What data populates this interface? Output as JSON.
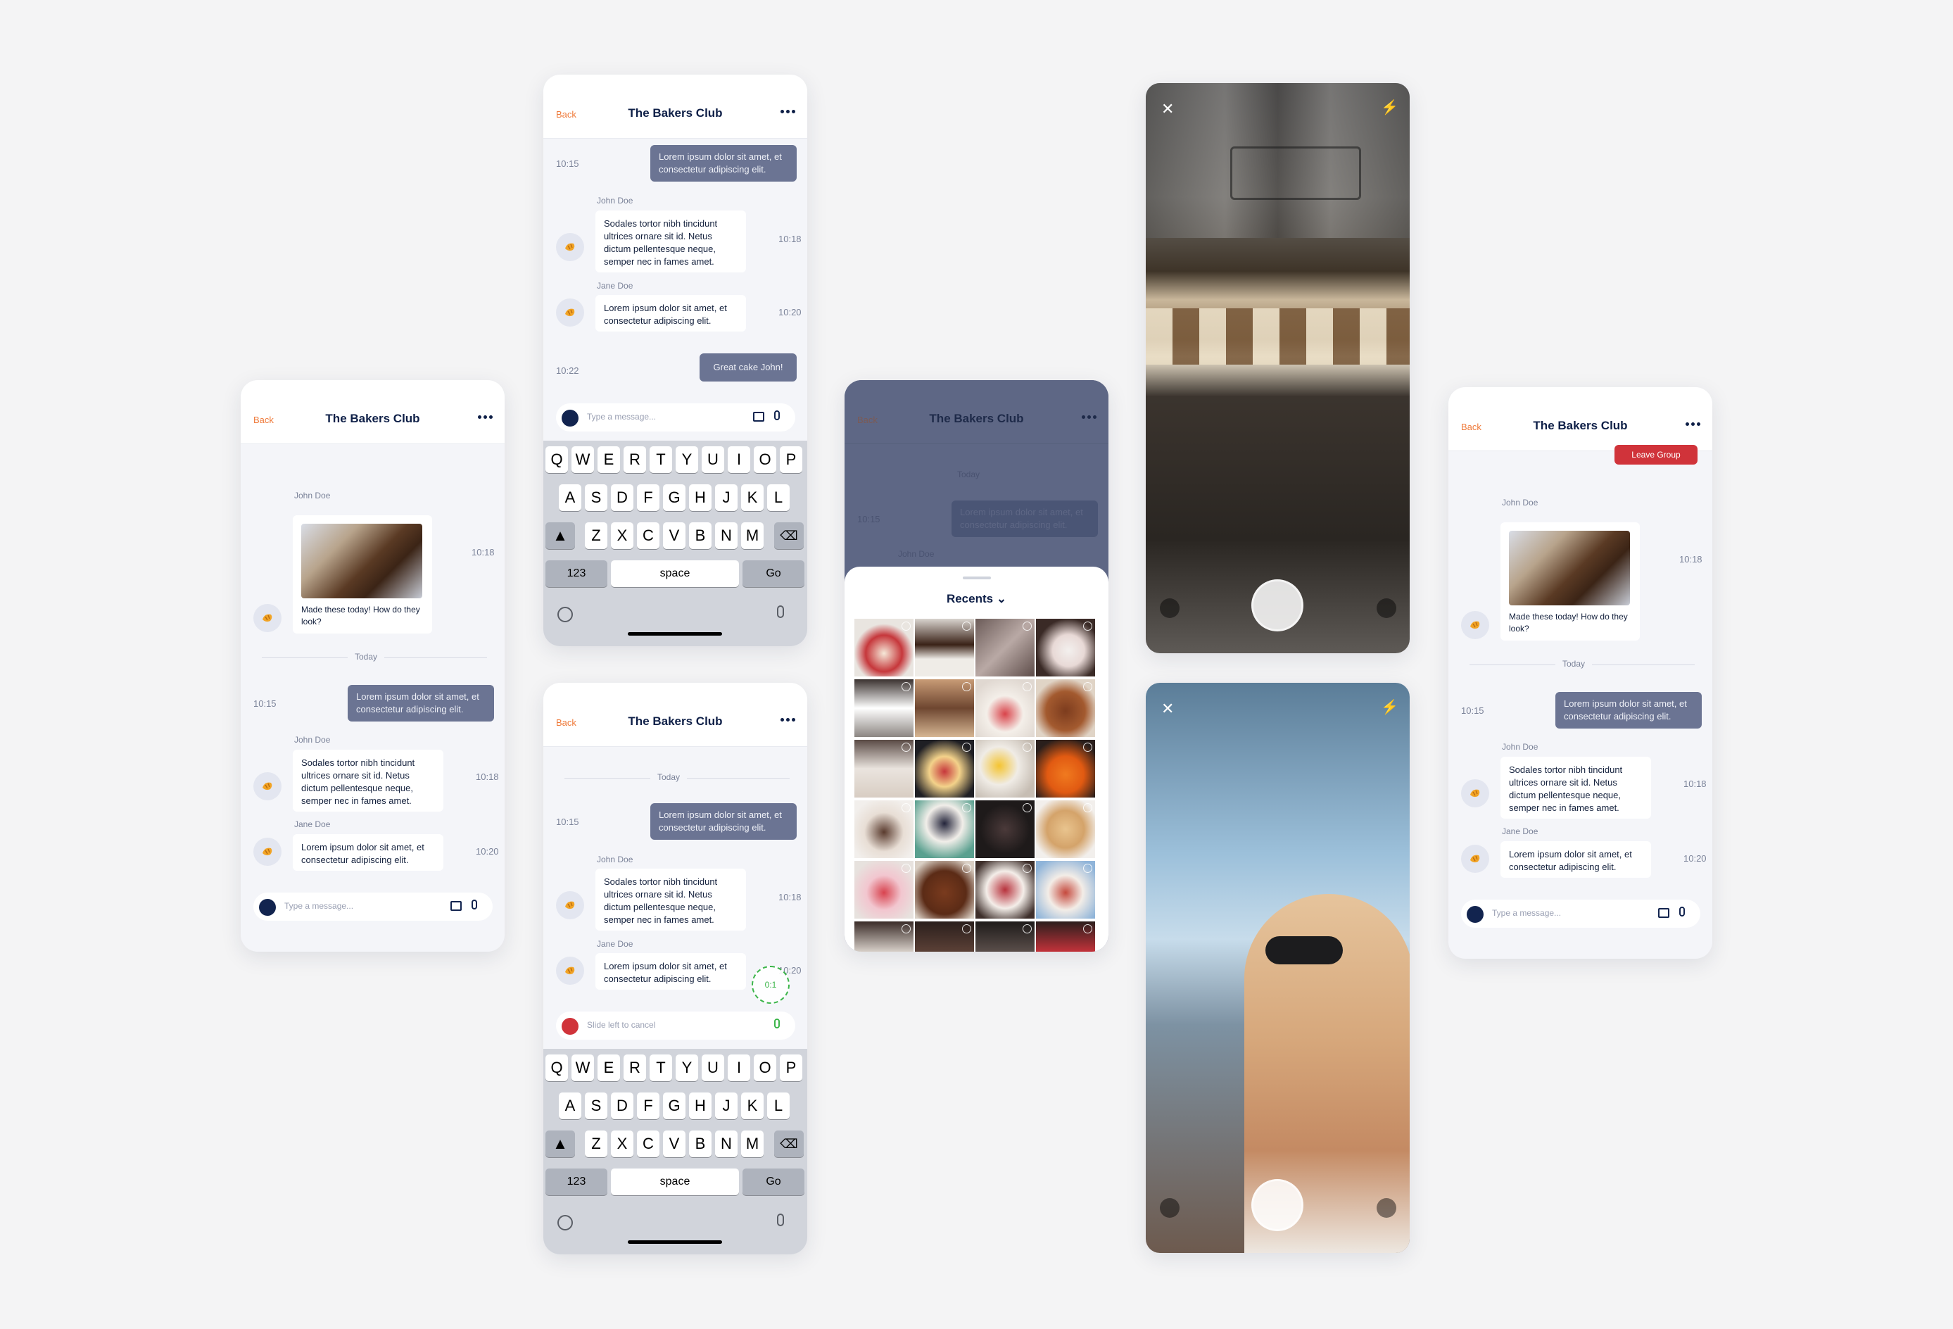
{
  "header": {
    "back": "Back",
    "title": "The Bakers Club"
  },
  "composer": {
    "placeholder": "Type a message..."
  },
  "messages": {
    "john": "John Doe",
    "jane": "Jane Doe",
    "photo_caption": "Made these today! How do they look?",
    "today": "Today",
    "lorem_out": "Lorem ipsum dolor sit amet, et consectetur adipiscing elit.",
    "sodales": "Sodales tortor nibh tincidunt ultrices ornare sit id. Netus dictum pellentesque neque, semper nec in fames amet.",
    "lorem_in": "Lorem ipsum dolor sit amet, et consectetur adipiscing elit.",
    "great": "Great cake John!",
    "times": {
      "t1015": "10:15",
      "t1018": "10:18",
      "t1020": "10:20",
      "t1022": "10:22"
    }
  },
  "keyboard": {
    "row1": [
      "Q",
      "W",
      "E",
      "R",
      "T",
      "Y",
      "U",
      "I",
      "O",
      "P"
    ],
    "row2": [
      "A",
      "S",
      "D",
      "F",
      "G",
      "H",
      "J",
      "K",
      "L"
    ],
    "row3": [
      "Z",
      "X",
      "C",
      "V",
      "B",
      "N",
      "M"
    ],
    "num": "123",
    "space": "space",
    "go": "Go"
  },
  "recording": {
    "cancel": "Slide left to cancel",
    "timer": "0:1"
  },
  "picker": {
    "title": "Recents"
  },
  "menu": {
    "leave": "Leave Group"
  },
  "colors": {
    "accent": "#ef7a3a",
    "navy": "#0e1f47",
    "bubble": "#6b7493",
    "danger": "#d0333a"
  }
}
